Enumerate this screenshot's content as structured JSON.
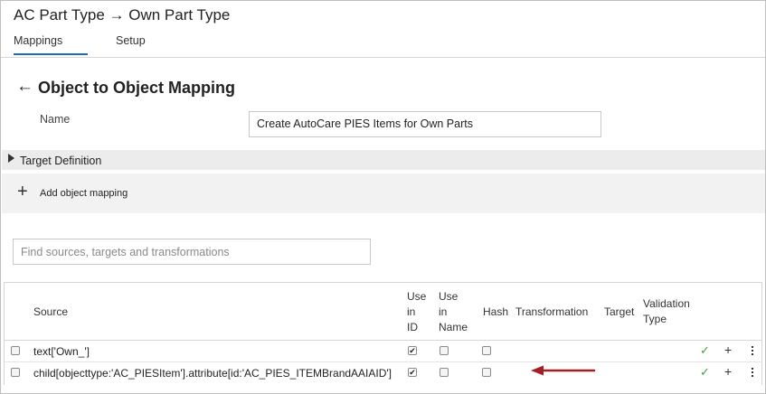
{
  "window": {
    "title": "AC Part Type → Own Part Type"
  },
  "tabs": [
    {
      "label": "Mappings",
      "active": true
    },
    {
      "label": "Setup",
      "active": false
    }
  ],
  "page": {
    "heading": "Object to Object Mapping",
    "back_icon": "arrow-left-icon"
  },
  "form": {
    "name_label": "Name",
    "name_value": "Create AutoCare PIES Items for Own Parts"
  },
  "target_definition": {
    "label": "Target Definition",
    "expanded": false
  },
  "add_object_mapping": {
    "label": "Add object mapping",
    "icon": "plus-icon"
  },
  "search": {
    "placeholder": "Find sources, targets and transformations",
    "value": ""
  },
  "table": {
    "headers": {
      "source": "Source",
      "use_in_id": [
        "Use",
        "in",
        "ID"
      ],
      "use_in_name": [
        "Use",
        "in",
        "Name"
      ],
      "hash": "Hash",
      "transformation": "Transformation",
      "target": "Target",
      "validation_type": [
        "Validation",
        "Type"
      ]
    },
    "rows": [
      {
        "selected": false,
        "source": "text['Own_']",
        "use_in_id": true,
        "use_in_name": false,
        "hash": false,
        "transformation": "",
        "target": "",
        "validation": "check-icon"
      },
      {
        "selected": false,
        "source": "child[objecttype:'AC_PIESItem'].attribute[id:'AC_PIES_ITEMBrandAAIAID']",
        "use_in_id": true,
        "use_in_name": false,
        "hash": false,
        "transformation": "",
        "target": "",
        "validation": "check-icon"
      }
    ]
  },
  "colors": {
    "accent": "#1f6fb5",
    "valid": "#3aa43a",
    "annotation_arrow": "#a31f24"
  }
}
